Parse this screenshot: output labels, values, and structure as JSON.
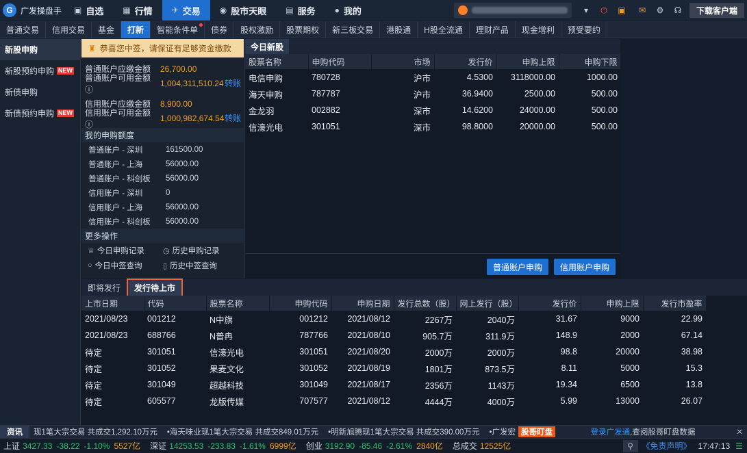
{
  "app": {
    "name": "广发操盘手",
    "download_label": "下载客户端"
  },
  "topnav": [
    {
      "label": "自选",
      "icon": "square-icon"
    },
    {
      "label": "行情",
      "icon": "chart-icon"
    },
    {
      "label": "交易",
      "icon": "trade-icon",
      "active": true
    },
    {
      "label": "股市天眼",
      "icon": "eye-icon"
    },
    {
      "label": "服务",
      "icon": "briefcase-icon"
    },
    {
      "label": "我的",
      "icon": "person-icon"
    }
  ],
  "subtabs": [
    "普通交易",
    "信用交易",
    "基金",
    "打新",
    "智能条件单",
    "债券",
    "股权激励",
    "股票期权",
    "新三板交易",
    "港股通",
    "H股全流通",
    "理财产品",
    "现金增利",
    "预受要约"
  ],
  "subtabs_active": 3,
  "leftnav": [
    {
      "label": "新股申购",
      "active": true,
      "badge": ""
    },
    {
      "label": "新股预约申购",
      "badge": "NEW"
    },
    {
      "label": "新债申购",
      "badge": ""
    },
    {
      "label": "新债预约申购",
      "badge": "NEW"
    }
  ],
  "notice": "恭喜您中签，请保证有足够资金缴款",
  "funds": [
    {
      "label": "普通账户应缴金额",
      "value": "26,700.00",
      "link": ""
    },
    {
      "label": "普通账户可用金额 ⓘ",
      "value": "1,004,311,510.24",
      "link": "转账"
    },
    {
      "label": "信用账户应缴金额",
      "value": "8,900.00",
      "link": ""
    },
    {
      "label": "信用账户可用金额 ⓘ",
      "value": "1,000,982,674.54",
      "link": "转账"
    }
  ],
  "quota_title": "我的申购额度",
  "quota": [
    {
      "label": "普通账户 - 深圳",
      "value": "161500.00"
    },
    {
      "label": "普通账户 - 上海",
      "value": "56000.00"
    },
    {
      "label": "普通账户 - 科创板",
      "value": "56000.00"
    },
    {
      "label": "信用账户 - 深圳",
      "value": "0"
    },
    {
      "label": "信用账户 - 上海",
      "value": "56000.00"
    },
    {
      "label": "信用账户 - 科创板",
      "value": "56000.00"
    }
  ],
  "more_title": "更多操作",
  "more_ops": [
    {
      "label": "今日申购记录",
      "icon": "trophy-icon"
    },
    {
      "label": "历史申购记录",
      "icon": "clock-icon"
    },
    {
      "label": "今日中签查询",
      "icon": "search-icon"
    },
    {
      "label": "历史中签查询",
      "icon": "document-icon"
    }
  ],
  "today": {
    "tab": "今日新股",
    "headers": [
      "股票名称",
      "申购代码",
      "市场",
      "发行价",
      "申购上限",
      "申购下限"
    ],
    "rows": [
      [
        "电信申购",
        "780728",
        "沪市",
        "4.5300",
        "3118000.00",
        "1000.00"
      ],
      [
        "海天申购",
        "787787",
        "沪市",
        "36.9400",
        "2500.00",
        "500.00"
      ],
      [
        "金龙羽",
        "002882",
        "深市",
        "14.6200",
        "24000.00",
        "500.00"
      ],
      [
        "信濠光电",
        "301051",
        "深市",
        "98.8000",
        "20000.00",
        "500.00"
      ]
    ],
    "buttons": [
      "普通账户申购",
      "信用账户申购"
    ]
  },
  "lower_tabs": [
    "即将发行",
    "发行待上市"
  ],
  "lower_tabs_active": 1,
  "lower": {
    "headers": [
      "上市日期",
      "代码",
      "股票名称",
      "申购代码",
      "申购日期",
      "发行总数（股）",
      "网上发行（股）",
      "发行价",
      "申购上限",
      "发行市盈率"
    ],
    "rows": [
      [
        "2021/08/23",
        "001212",
        "N中旗",
        "001212",
        "2021/08/12",
        "2267万",
        "2040万",
        "31.67",
        "9000",
        "22.99"
      ],
      [
        "2021/08/23",
        "688766",
        "N普冉",
        "787766",
        "2021/08/10",
        "905.7万",
        "311.9万",
        "148.9",
        "2000",
        "67.14"
      ],
      [
        "待定",
        "301051",
        "信濠光电",
        "301051",
        "2021/08/20",
        "2000万",
        "2000万",
        "98.8",
        "20000",
        "38.98"
      ],
      [
        "待定",
        "301052",
        "果麦文化",
        "301052",
        "2021/08/19",
        "1801万",
        "873.5万",
        "8.11",
        "5000",
        "15.3"
      ],
      [
        "待定",
        "301049",
        "超越科技",
        "301049",
        "2021/08/17",
        "2356万",
        "1143万",
        "19.34",
        "6500",
        "13.8"
      ],
      [
        "待定",
        "605577",
        "龙版传媒",
        "707577",
        "2021/08/12",
        "4444万",
        "4000万",
        "5.99",
        "13000",
        "26.07"
      ]
    ]
  },
  "ticker": {
    "tag": "资讯",
    "items": [
      "现1笔大宗交易 共成交1,292.10万元",
      "•海天味业现1笔大宗交易 共成交849.01万元",
      "•明新旭腾现1笔大宗交易 共成交390.00万元",
      "•广发宏"
    ],
    "hot": "股哥盯盘",
    "login": "登录广发通",
    "login_suffix": ",查阅股哥盯盘数据"
  },
  "status": {
    "indices": [
      {
        "name": "上证",
        "value": "3427.33",
        "change": "-38.22",
        "pct": "-1.10%",
        "amount": "5527亿"
      },
      {
        "name": "深证",
        "value": "14253.53",
        "change": "-233.83",
        "pct": "-1.61%",
        "amount": "6999亿"
      },
      {
        "name": "创业",
        "value": "3192.90",
        "change": "-85.46",
        "pct": "-2.61%",
        "amount": "2840亿"
      }
    ],
    "total_label": "总成交",
    "total": "12525亿",
    "disclaimer": "《免责声明》",
    "time": "17:47:13"
  }
}
